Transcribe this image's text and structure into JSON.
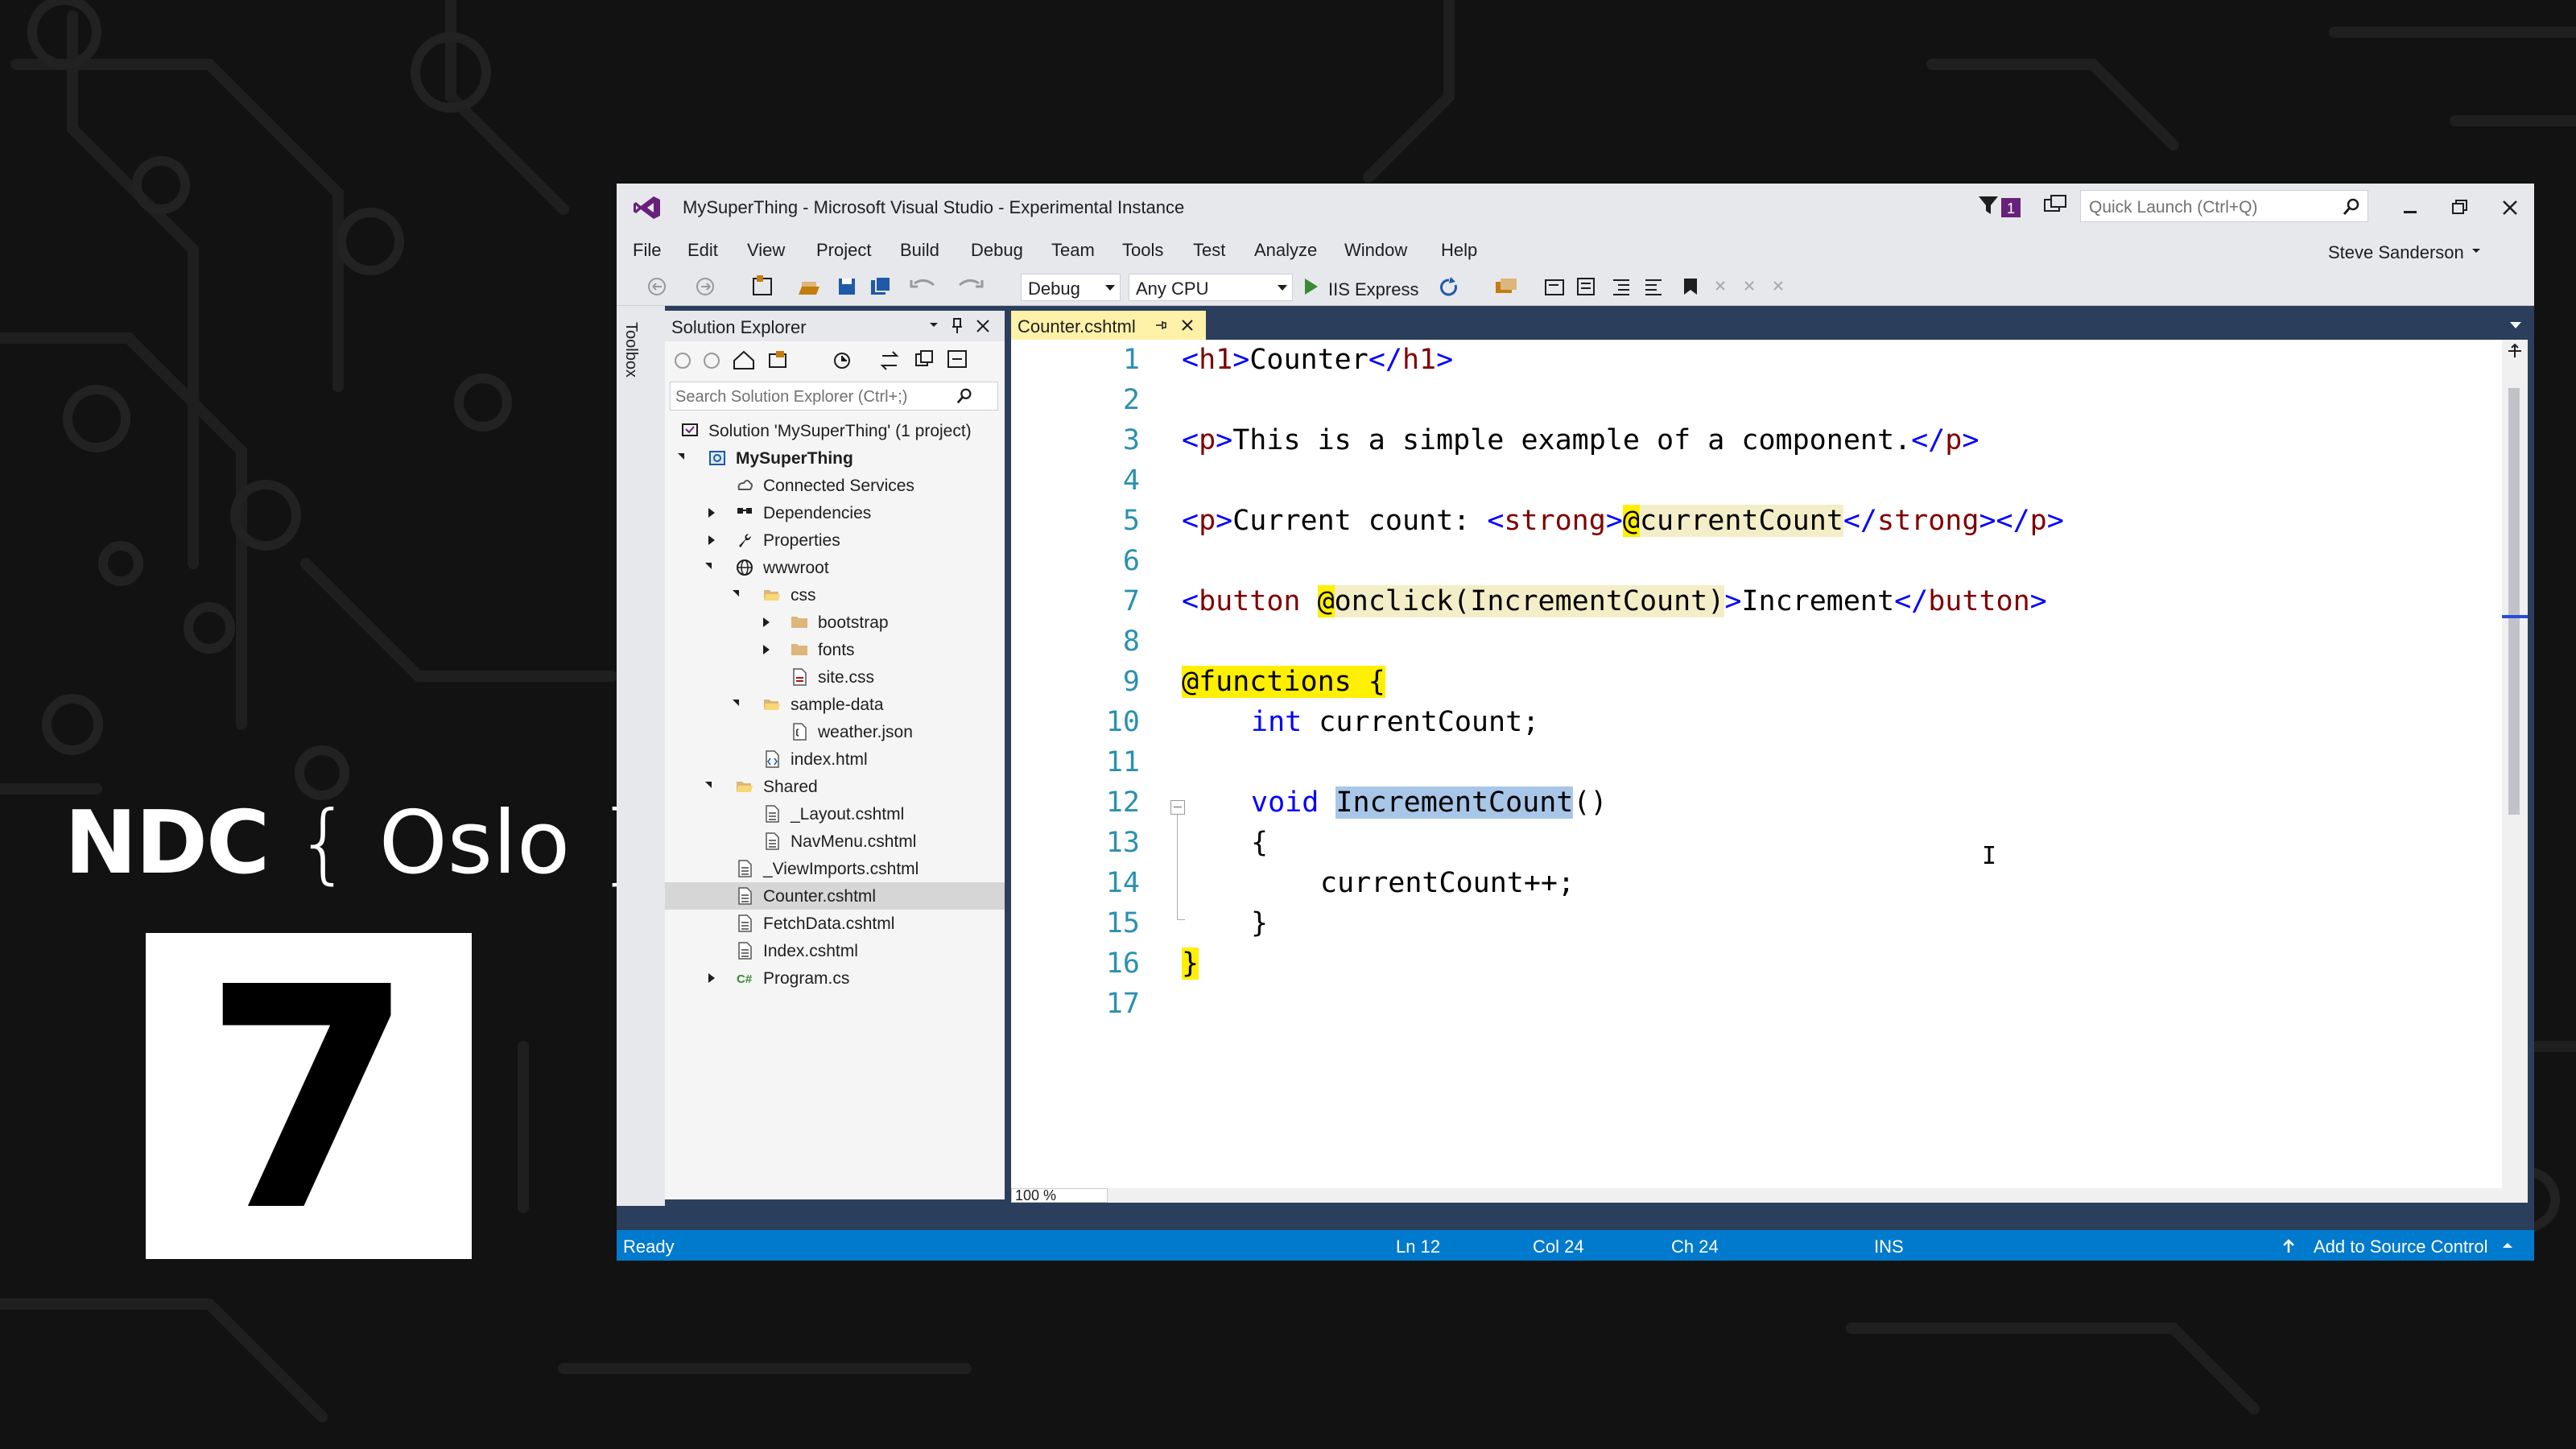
{
  "overlay": {
    "ndc_brand": "NDC",
    "ndc_open": "{",
    "ndc_city": "Oslo",
    "ndc_close": "}",
    "number": "7"
  },
  "window": {
    "title": "MySuperThing - Microsoft Visual Studio - Experimental Instance",
    "filter_badge": "1",
    "quick_launch_placeholder": "Quick Launch (Ctrl+Q)",
    "user": "Steve Sanderson"
  },
  "menu": [
    "File",
    "Edit",
    "View",
    "Project",
    "Build",
    "Debug",
    "Team",
    "Tools",
    "Test",
    "Analyze",
    "Window",
    "Help"
  ],
  "toolbar": {
    "config": "Debug",
    "platform": "Any CPU",
    "run_target": "IIS Express"
  },
  "toolbox_label": "Toolbox",
  "solution_explorer": {
    "title": "Solution Explorer",
    "search_placeholder": "Search Solution Explorer (Ctrl+;)",
    "items": [
      {
        "label": "Solution 'MySuperThing' (1 project)",
        "icon": "solution-icon"
      },
      {
        "label": "MySuperThing",
        "icon": "web-project-icon"
      },
      {
        "label": "Connected Services",
        "icon": "connected-services-icon"
      },
      {
        "label": "Dependencies",
        "icon": "dependencies-icon"
      },
      {
        "label": "Properties",
        "icon": "wrench-icon"
      },
      {
        "label": "wwwroot",
        "icon": "globe-icon"
      },
      {
        "label": "css",
        "icon": "folder-open-icon"
      },
      {
        "label": "bootstrap",
        "icon": "folder-icon"
      },
      {
        "label": "fonts",
        "icon": "folder-icon"
      },
      {
        "label": "site.css",
        "icon": "css-file-icon"
      },
      {
        "label": "sample-data",
        "icon": "folder-open-icon"
      },
      {
        "label": "weather.json",
        "icon": "json-file-icon"
      },
      {
        "label": "index.html",
        "icon": "html-file-icon"
      },
      {
        "label": "Shared",
        "icon": "folder-open-icon"
      },
      {
        "label": "_Layout.cshtml",
        "icon": "file-icon"
      },
      {
        "label": "NavMenu.cshtml",
        "icon": "file-icon"
      },
      {
        "label": "_ViewImports.cshtml",
        "icon": "file-icon"
      },
      {
        "label": "Counter.cshtml",
        "icon": "file-icon"
      },
      {
        "label": "FetchData.cshtml",
        "icon": "file-icon"
      },
      {
        "label": "Index.cshtml",
        "icon": "file-icon"
      },
      {
        "label": "Program.cs",
        "icon": "csharp-file-icon"
      }
    ]
  },
  "editor": {
    "tab": "Counter.cshtml",
    "line_numbers": [
      "1",
      "2",
      "3",
      "4",
      "5",
      "6",
      "7",
      "8",
      "9",
      "10",
      "11",
      "12",
      "13",
      "14",
      "15",
      "16",
      "17"
    ],
    "code": {
      "l1_open": "<",
      "l1_tag": "h1",
      "l1_mid": ">Counter</",
      "l1_tag2": "h1",
      "l1_close": ">",
      "l3_tag": "p",
      "l3_text": "This is a simple example of a component.",
      "l5_tag": "p",
      "l5_text": "Current count: ",
      "l5_tag2": "strong",
      "l5_at": "@",
      "l5_expr": "currentCount",
      "l7_tag": "button",
      "l7_at": "@",
      "l7_attr": "onclick(",
      "l7_arg": "IncrementCount",
      "l7_paren": ")",
      "l7_text": "Increment",
      "l9_at": "@functions {",
      "l10_kw": "int",
      "l10_rest": " currentCount;",
      "l12_kw": "void",
      "l12_name": "IncrementCount",
      "l12_parens": "()",
      "l13": "{",
      "l14": "currentCount++;",
      "l15": "}",
      "l16": "}"
    },
    "zoom": "100 %"
  },
  "status": {
    "ready": "Ready",
    "ln": "Ln 12",
    "col": "Col 24",
    "ch": "Ch 24",
    "ins": "INS",
    "source_control": "Add to Source Control"
  }
}
